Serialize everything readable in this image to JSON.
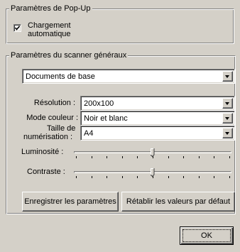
{
  "popup_group": {
    "legend": "Paramètres de Pop-Up",
    "auto_load": {
      "label_line1": "Chargement",
      "label_line2": "automatique",
      "checked": true
    }
  },
  "scanner_group": {
    "legend": "Paramètres du scanner généraux",
    "profile": {
      "value": "Documents de base"
    },
    "resolution": {
      "label": "Résolution :",
      "value": "200x100"
    },
    "color_mode": {
      "label": "Mode couleur :",
      "value": "Noir et blanc"
    },
    "scan_size": {
      "label_line1": "Taille de",
      "label_line2": "numérisation :",
      "value": "A4"
    },
    "brightness": {
      "label": "Luminosité :",
      "level": 0.5
    },
    "contrast": {
      "label": "Contraste :",
      "level": 0.5
    },
    "save_button": "Enregistrer les paramètres",
    "reset_button": "Rétablir les valeurs par défaut"
  },
  "ok_button": "OK"
}
